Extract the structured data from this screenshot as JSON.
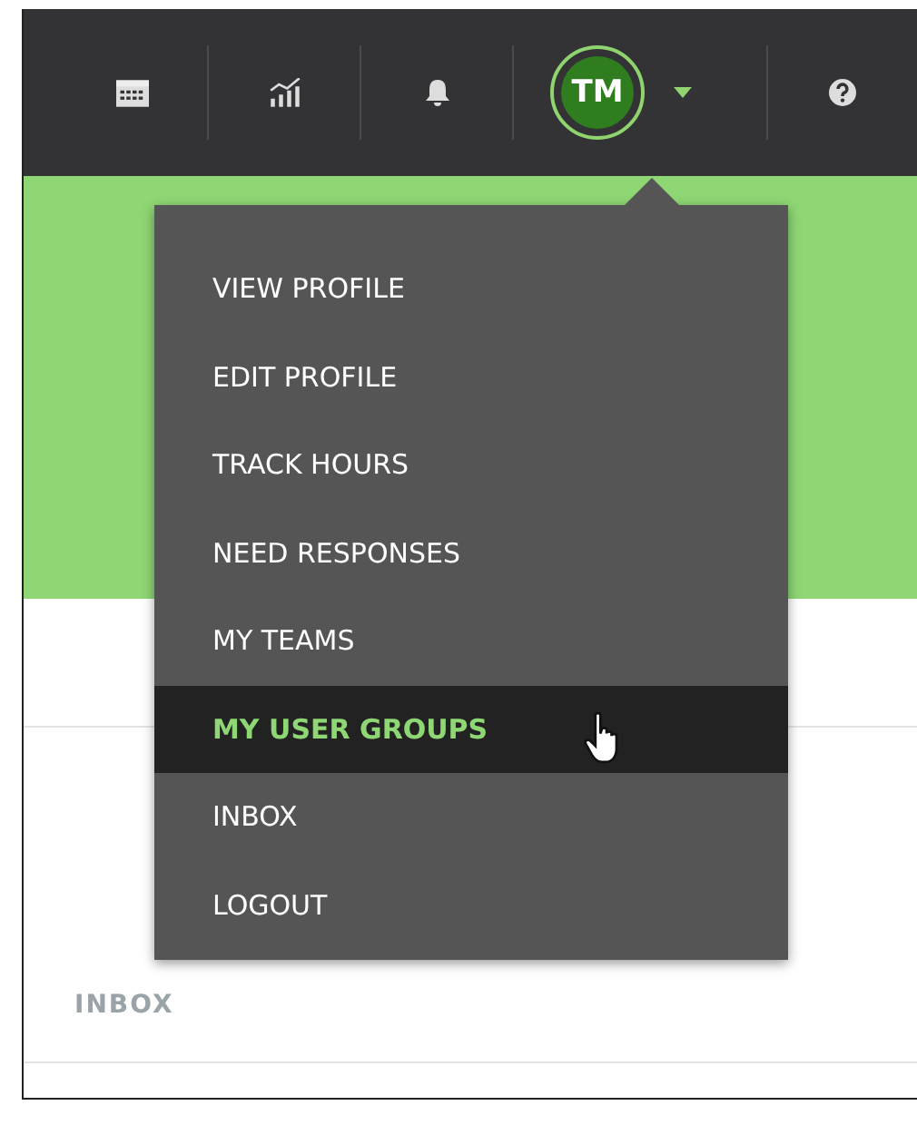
{
  "navbar": {
    "items": [
      {
        "kind": "calendar"
      },
      {
        "kind": "chart"
      },
      {
        "kind": "bell"
      },
      {
        "kind": "avatar",
        "initials": "TM"
      },
      {
        "kind": "help"
      }
    ]
  },
  "menu": {
    "items": [
      {
        "label": "VIEW PROFILE",
        "selected": false
      },
      {
        "label": "EDIT PROFILE",
        "selected": false
      },
      {
        "label": "TRACK HOURS",
        "selected": false
      },
      {
        "label": "NEED RESPONSES",
        "selected": false
      },
      {
        "label": "MY TEAMS",
        "selected": false
      },
      {
        "label": "MY USER GROUPS",
        "selected": true
      },
      {
        "label": "INBOX",
        "selected": false
      },
      {
        "label": "LOGOUT",
        "selected": false
      }
    ]
  },
  "section": {
    "heading": "INBOX"
  }
}
